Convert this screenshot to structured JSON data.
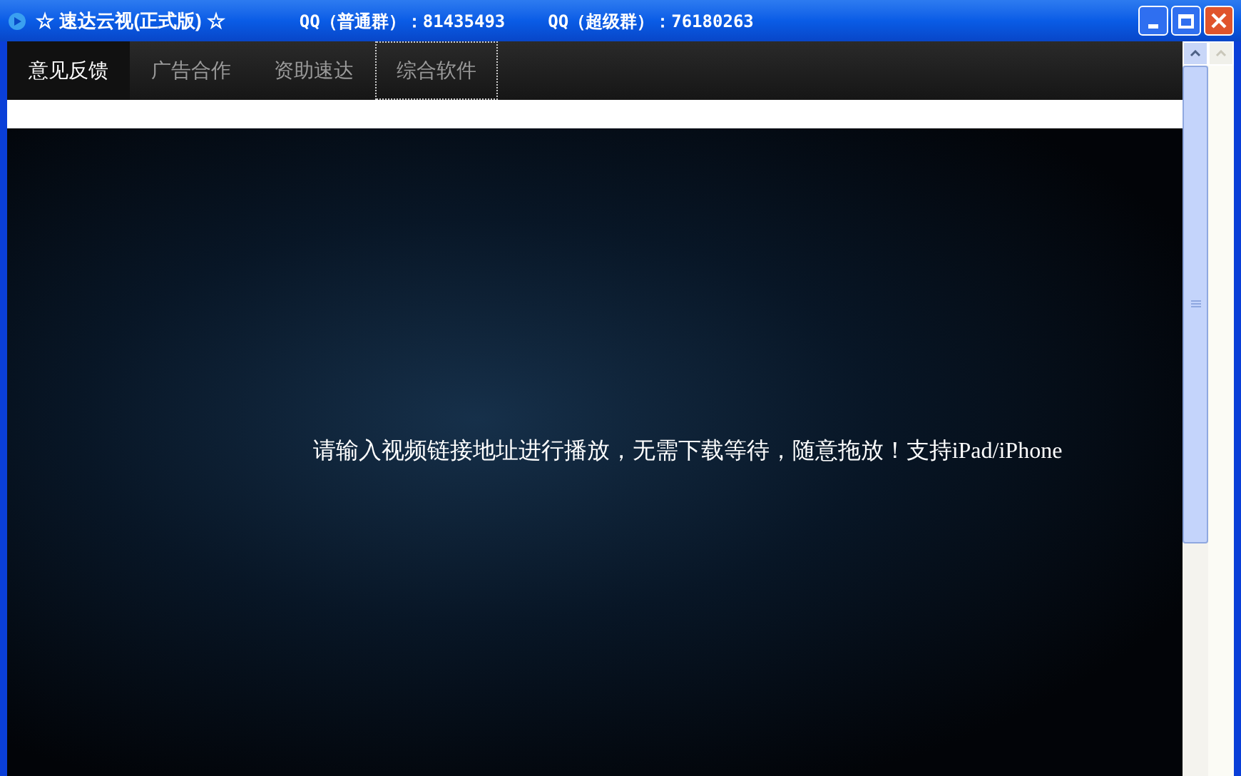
{
  "window": {
    "title": "☆ 速达云视(正式版) ☆",
    "qq_groups": [
      "QQ（普通群）：81435493",
      "QQ（超级群）：76180263"
    ]
  },
  "tabs": [
    {
      "label": "意见反馈",
      "selected": true,
      "focused": false
    },
    {
      "label": "广告合作",
      "selected": false,
      "focused": false
    },
    {
      "label": "资助速达",
      "selected": false,
      "focused": false
    },
    {
      "label": "综合软件",
      "selected": false,
      "focused": true
    }
  ],
  "player": {
    "message": "请输入视频链接地址进行播放，无需下载等待，随意拖放！支持iPad/iPhone"
  }
}
